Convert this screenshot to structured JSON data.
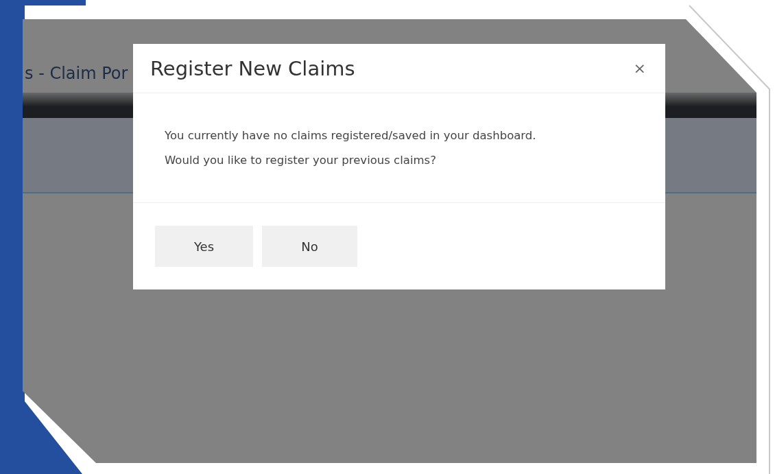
{
  "page": {
    "header_title": "s - Claim Por"
  },
  "modal": {
    "title": "Register New Claims",
    "close": "×",
    "message": [
      "You currently have no claims registered/saved in your dashboard.",
      "Would you like to register your previous claims?"
    ],
    "buttons": [
      {
        "label": "Yes"
      },
      {
        "label": "No"
      }
    ]
  }
}
